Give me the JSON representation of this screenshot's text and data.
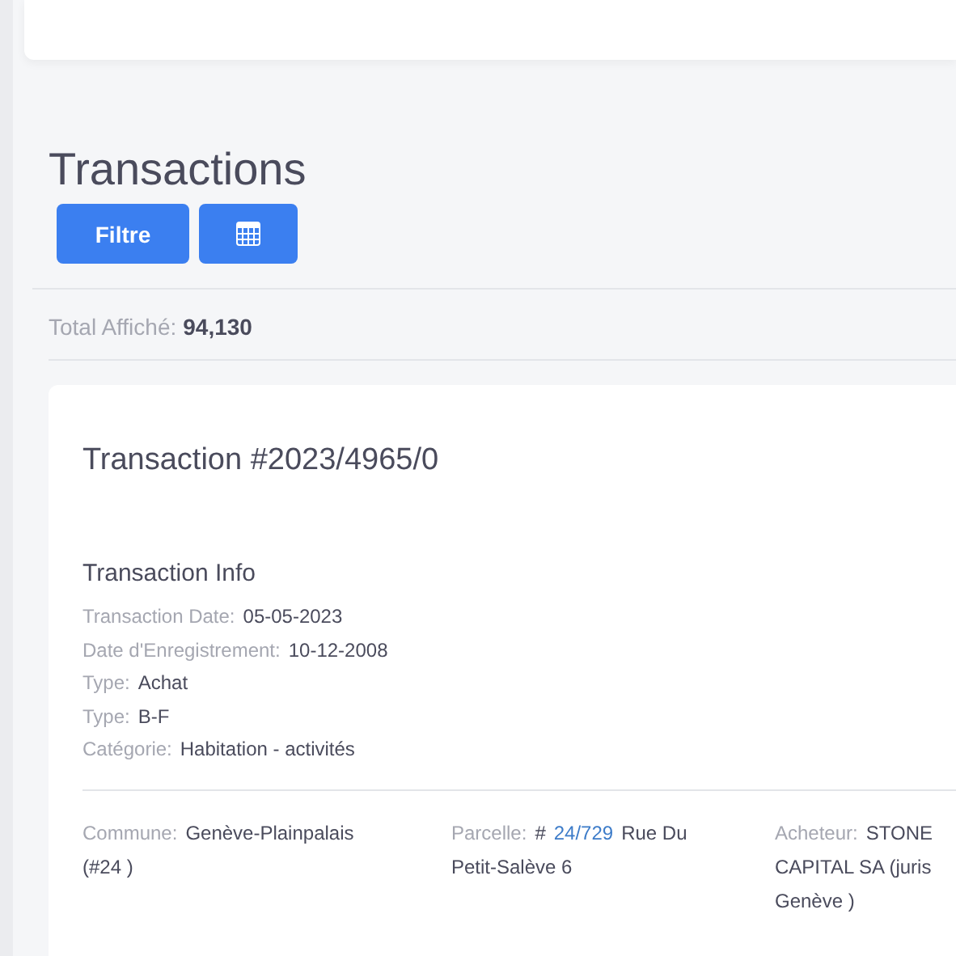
{
  "page_title": "Transactions",
  "toolbar": {
    "filter_button": "Filtre"
  },
  "summary": {
    "label": "Total Affiché:",
    "value": "94,130"
  },
  "transaction": {
    "title": "Transaction #2023/4965/0",
    "section_title": "Transaction Info",
    "fields": [
      {
        "label": "Transaction Date:",
        "value": "05-05-2023"
      },
      {
        "label": "Date d'Enregistrement:",
        "value": "10-12-2008"
      },
      {
        "label": "Type:",
        "value": "Achat"
      },
      {
        "label": "Type:",
        "value": "B-F"
      },
      {
        "label": "Catégorie:",
        "value": "Habitation - activités"
      }
    ],
    "details": [
      {
        "label": "Commune:",
        "lines": [
          "Genève-Plainpalais",
          "(#24 )"
        ]
      },
      {
        "label": "Parcelle:",
        "prefix": "#",
        "link": "24/729",
        "lines": [
          "Rue Du",
          "Petit-Salève 6"
        ]
      },
      {
        "label": "Acheteur:",
        "lines": [
          "STONE",
          "CAPITAL SA (juris",
          "Genève )"
        ]
      }
    ]
  }
}
